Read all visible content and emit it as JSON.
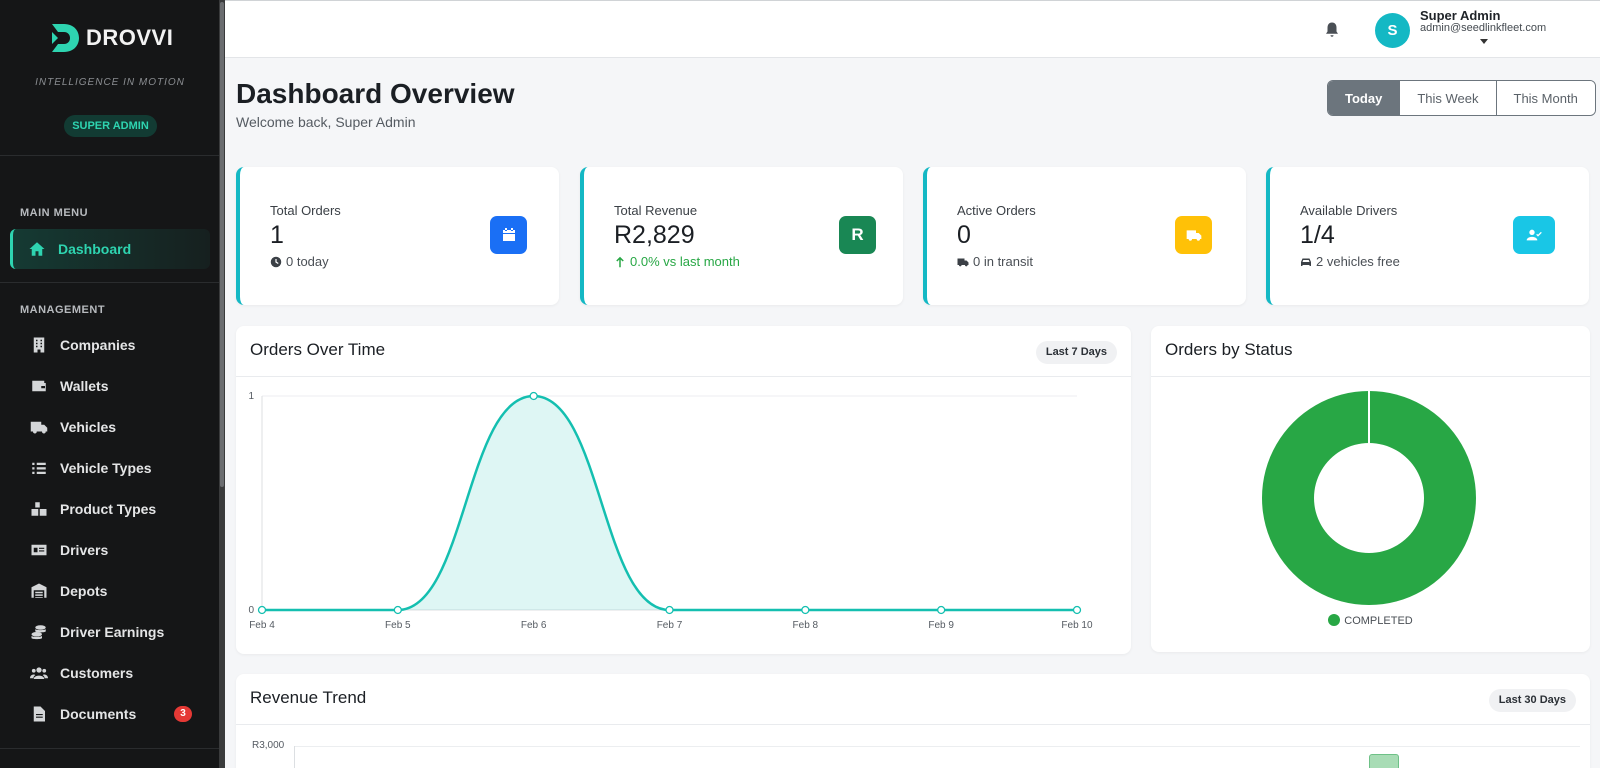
{
  "brand": {
    "name": "DROVVI",
    "tagline": "INTELLIGENCE IN MOTION",
    "role": "SUPER ADMIN"
  },
  "sidebar": {
    "main_menu_label": "MAIN MENU",
    "management_label": "MANAGEMENT",
    "items": [
      {
        "label": "Dashboard",
        "icon": "home-icon",
        "active": true
      },
      {
        "label": "Companies",
        "icon": "building-icon"
      },
      {
        "label": "Wallets",
        "icon": "wallet-icon"
      },
      {
        "label": "Vehicles",
        "icon": "truck-icon"
      },
      {
        "label": "Vehicle Types",
        "icon": "list-icon"
      },
      {
        "label": "Product Types",
        "icon": "boxes-icon"
      },
      {
        "label": "Drivers",
        "icon": "id-card-icon"
      },
      {
        "label": "Depots",
        "icon": "warehouse-icon"
      },
      {
        "label": "Driver Earnings",
        "icon": "coins-icon"
      },
      {
        "label": "Customers",
        "icon": "users-icon"
      },
      {
        "label": "Documents",
        "icon": "document-icon",
        "badge": "3"
      }
    ]
  },
  "topbar": {
    "user_initial": "S",
    "user_name": "Super Admin",
    "user_email": "admin@seedlinkfleet.com"
  },
  "header": {
    "title": "Dashboard Overview",
    "subtitle": "Welcome back, Super Admin",
    "ranges": [
      "Today",
      "This Week",
      "This Month"
    ],
    "active_range": "Today"
  },
  "stats": [
    {
      "label": "Total Orders",
      "value": "1",
      "sub": "0 today",
      "sub_icon": "clock-icon",
      "icon": "calendar-icon",
      "color": "#1a6ff5"
    },
    {
      "label": "Total Revenue",
      "value": "R2,829",
      "sub": "0.0% vs last month",
      "sub_icon": "arrow-up-icon",
      "icon_text": "R",
      "color": "#198754"
    },
    {
      "label": "Active Orders",
      "value": "0",
      "sub": "0 in transit",
      "sub_icon": "truck-icon",
      "icon": "shipping-icon",
      "color": "#ffc107"
    },
    {
      "label": "Available Drivers",
      "value": "1/4",
      "sub": "2 vehicles free",
      "sub_icon": "car-icon",
      "icon": "user-check-icon",
      "color": "#19c6e6"
    }
  ],
  "orders_panel": {
    "title": "Orders Over Time",
    "pill": "Last 7 Days"
  },
  "status_panel": {
    "title": "Orders by Status"
  },
  "revenue_panel": {
    "title": "Revenue Trend",
    "pill": "Last 30 Days",
    "y_top_label": "R3,000"
  },
  "chart_data": [
    {
      "type": "area",
      "title": "Orders Over Time",
      "x": [
        "Feb 4",
        "Feb 5",
        "Feb 6",
        "Feb 7",
        "Feb 8",
        "Feb 9",
        "Feb 10"
      ],
      "values": [
        0,
        0,
        1,
        0,
        0,
        0,
        0
      ],
      "ylim": [
        0,
        1
      ],
      "yticks": [
        "0",
        "1"
      ],
      "color": "#14bfb0"
    },
    {
      "type": "pie",
      "title": "Orders by Status",
      "labels": [
        "COMPLETED"
      ],
      "values": [
        1
      ],
      "colors": [
        "#28a745"
      ],
      "legend": "bottom"
    }
  ]
}
